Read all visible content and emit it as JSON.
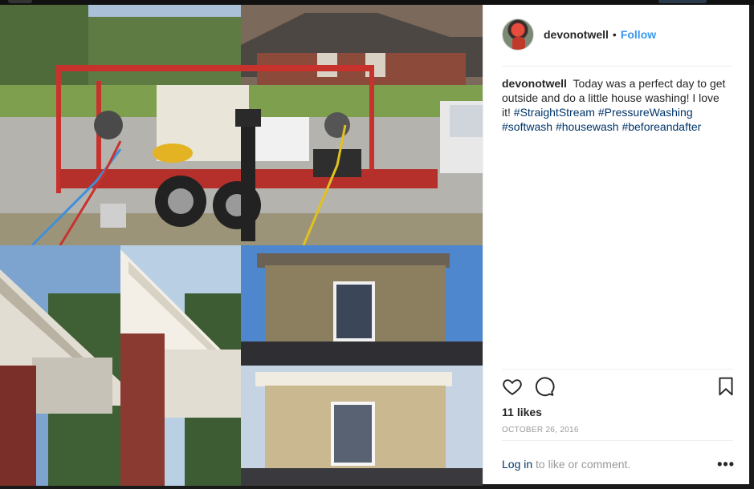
{
  "post": {
    "username": "devonotwell",
    "separator": "•",
    "follow_label": "Follow",
    "caption_text": "Today was a perfect day to get outside and do a little house washing! I love it!",
    "hashtags": [
      "#StraightStream",
      "#PressureWashing",
      "#softwash",
      "#housewash",
      "#beforeandafter"
    ],
    "likes_count": "11",
    "likes_label": "likes",
    "date": "OCTOBER 26, 2016",
    "login_link": "Log in",
    "login_suffix": "to like or comment.",
    "more_label": "•••"
  },
  "icons": {
    "like": "heart-icon",
    "comment": "comment-icon",
    "save": "bookmark-icon",
    "more": "more-options-icon"
  },
  "colors": {
    "link_blue": "#3897f0",
    "hashtag": "#003569",
    "text": "#262626",
    "muted": "#999999",
    "trailer_red": "#c8322d"
  }
}
